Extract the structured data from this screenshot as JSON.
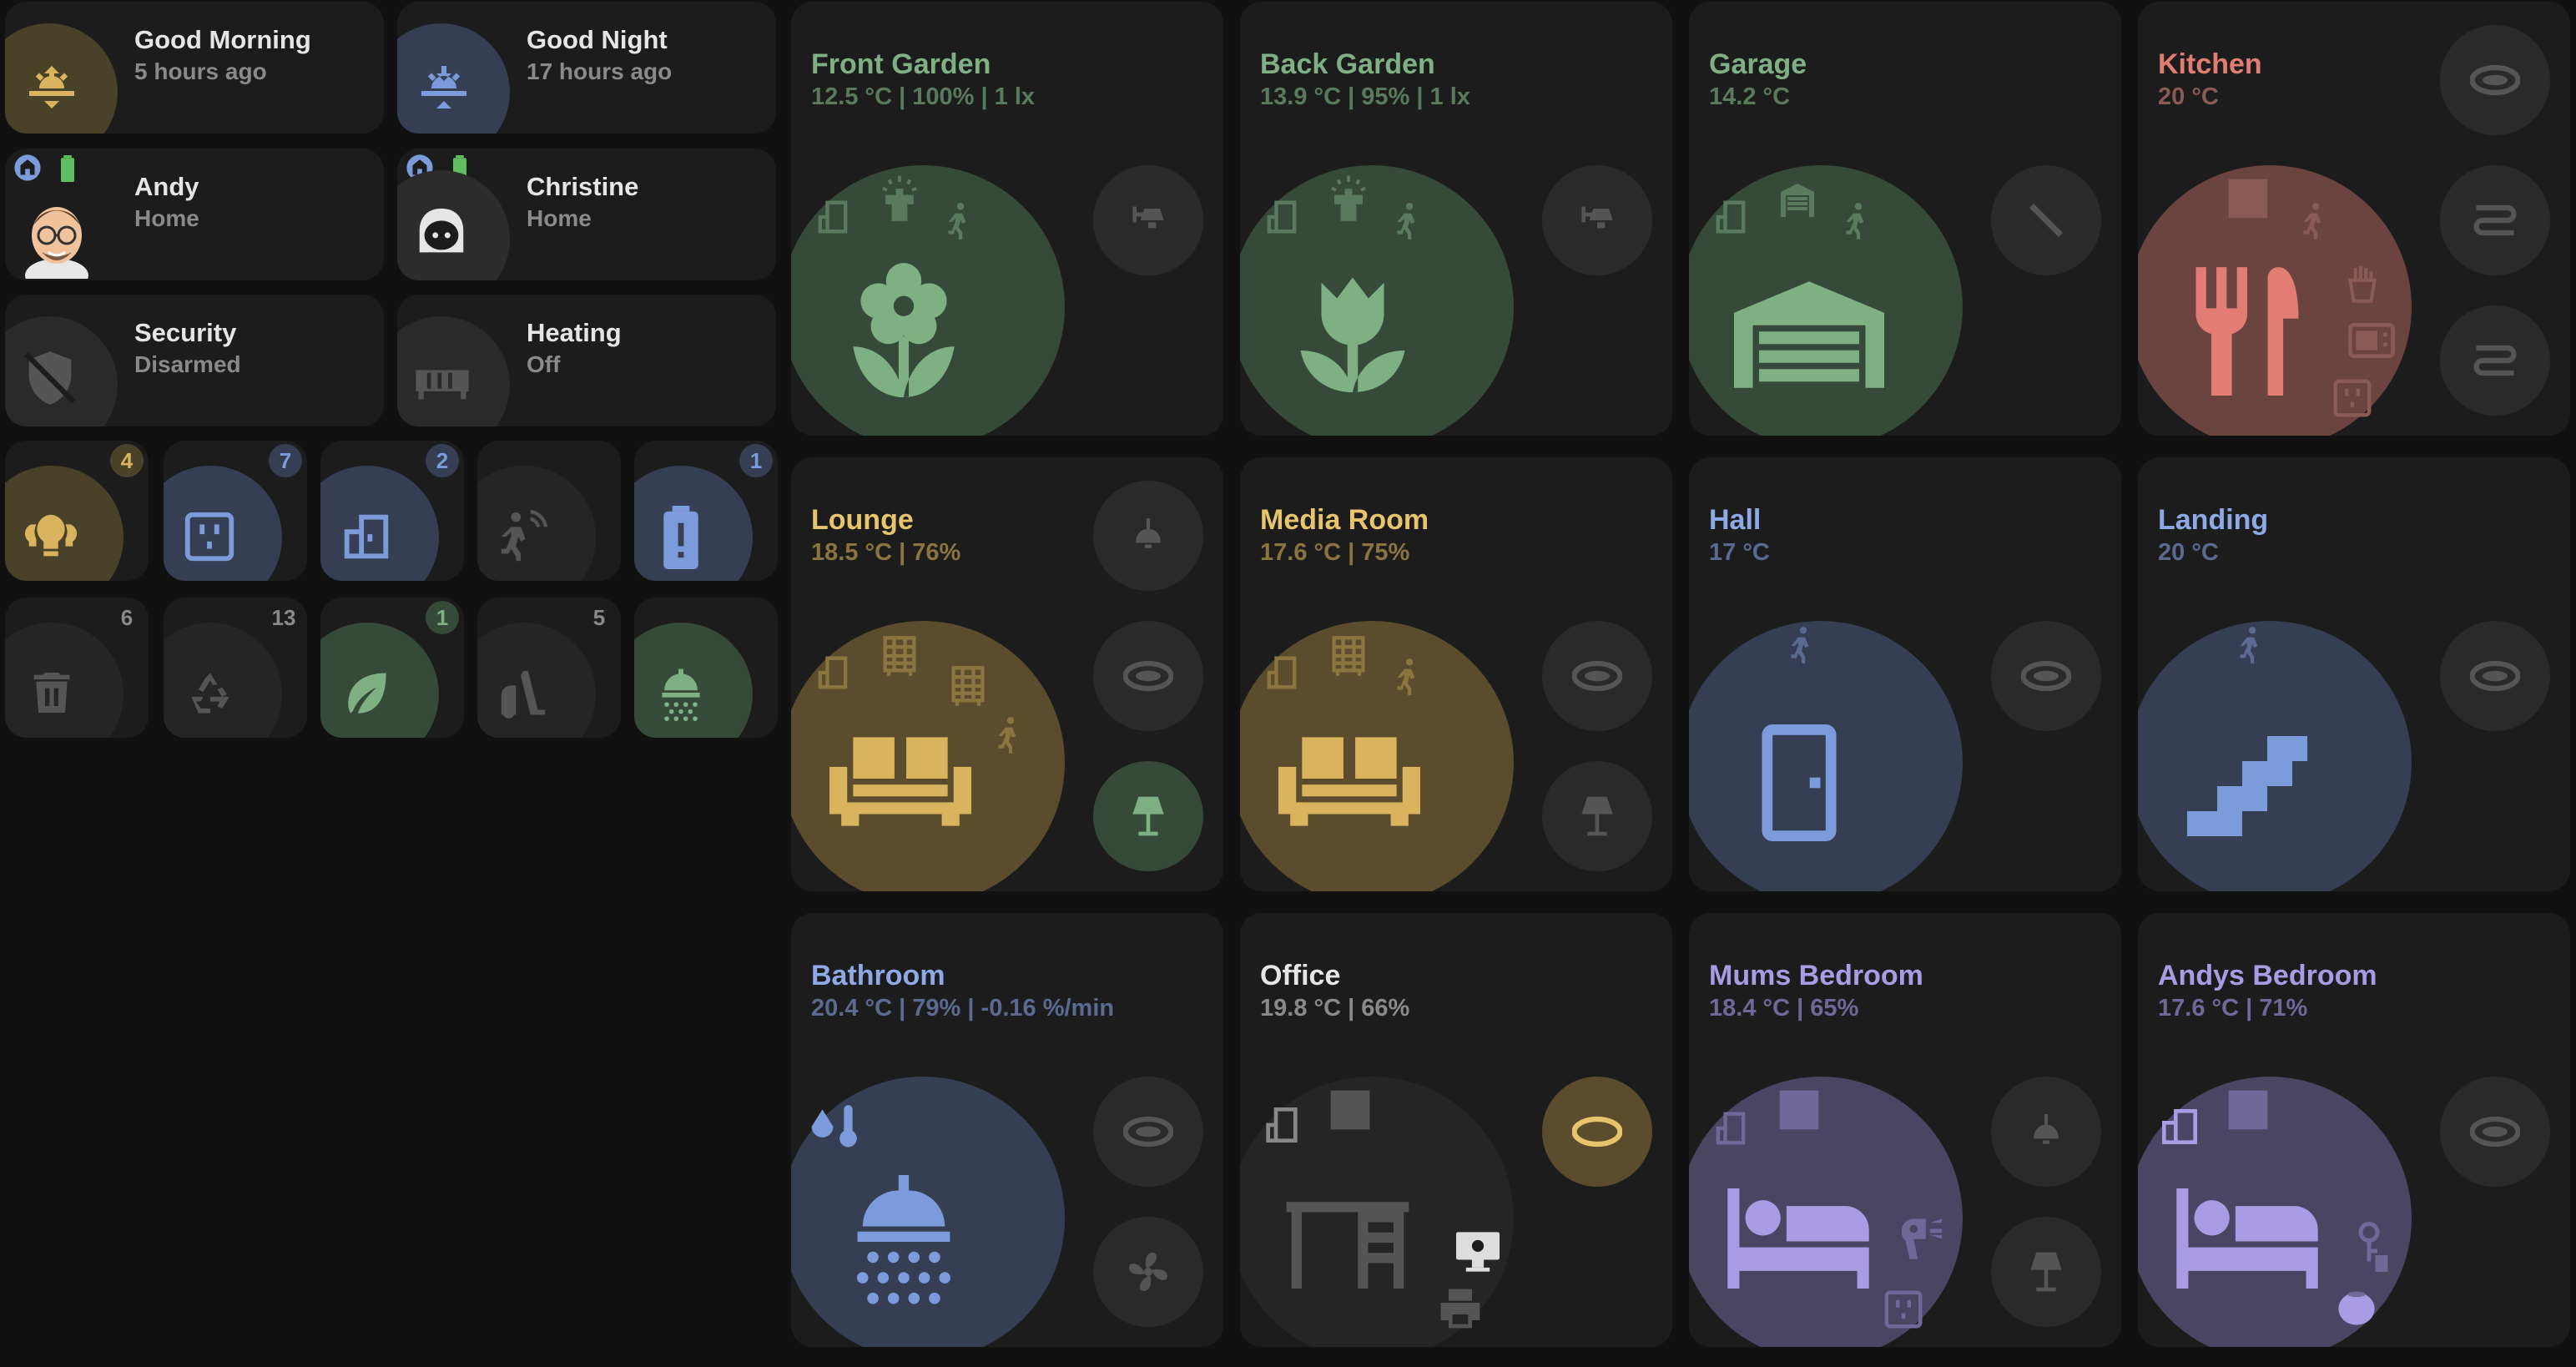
{
  "colors": {
    "garden": "#7eb083",
    "garden_bg": "#354a38",
    "kitchen": "#e27d73",
    "kitchen_bg": "#6b4440",
    "lounge": "#d9b35e",
    "lounge_bg": "#5b4c2d",
    "blue": "#7b9bdb",
    "blue_bg": "#353e52",
    "purple": "#a99ce4",
    "purple_bg": "#4a4562",
    "grey_icon": "#5a5a5a",
    "active_light": "#7eb083"
  },
  "scenes": [
    {
      "title": "Good Morning",
      "sub": "5 hours ago",
      "icon": "sunrise-icon"
    },
    {
      "title": "Good Night",
      "sub": "17 hours ago",
      "icon": "sunset-icon"
    }
  ],
  "people": [
    {
      "name": "Andy",
      "state": "Home",
      "icon": "avatar-andy"
    },
    {
      "name": "Christine",
      "state": "Home",
      "icon": "avatar-christine"
    }
  ],
  "status": [
    {
      "title": "Security",
      "sub": "Disarmed",
      "icon": "shield-off-icon"
    },
    {
      "title": "Heating",
      "sub": "Off",
      "icon": "radiator-icon"
    }
  ],
  "counters_row1": [
    {
      "name": "lights",
      "count": "4",
      "icon": "lightbulb-group-icon"
    },
    {
      "name": "sockets",
      "count": "7",
      "icon": "power-socket-icon"
    },
    {
      "name": "doors",
      "count": "2",
      "icon": "door-open-icon"
    },
    {
      "name": "motion",
      "count": "",
      "icon": "motion-sensor-icon"
    },
    {
      "name": "battery",
      "count": "1",
      "icon": "battery-alert-icon"
    }
  ],
  "counters_row2": [
    {
      "name": "bin",
      "count": "6",
      "icon": "trash-icon"
    },
    {
      "name": "recycling",
      "count": "13",
      "icon": "recycle-icon"
    },
    {
      "name": "garden-waste",
      "count": "1",
      "icon": "leaf-icon"
    },
    {
      "name": "vacuum",
      "count": "5",
      "icon": "vacuum-icon"
    },
    {
      "name": "shower",
      "count": "",
      "icon": "shower-icon"
    }
  ],
  "rooms": [
    {
      "name": "Front Garden",
      "sub": "12.5 °C | 100% | 1 lx"
    },
    {
      "name": "Back Garden",
      "sub": "13.9 °C | 95% | 1 lx"
    },
    {
      "name": "Garage",
      "sub": "14.2 °C"
    },
    {
      "name": "Kitchen",
      "sub": "20 °C"
    },
    {
      "name": "Lounge",
      "sub": "18.5 °C | 76%"
    },
    {
      "name": "Media Room",
      "sub": "17.6 °C | 75%"
    },
    {
      "name": "Hall",
      "sub": "17 °C"
    },
    {
      "name": "Landing",
      "sub": "20 °C"
    },
    {
      "name": "Bathroom",
      "sub": "20.4 °C | 79% | -0.16 %/min"
    },
    {
      "name": "Office",
      "sub": "19.8 °C | 66%"
    },
    {
      "name": "Mums Bedroom",
      "sub": "18.4 °C | 65%"
    },
    {
      "name": "Andys Bedroom",
      "sub": "17.6 °C | 71%"
    }
  ]
}
